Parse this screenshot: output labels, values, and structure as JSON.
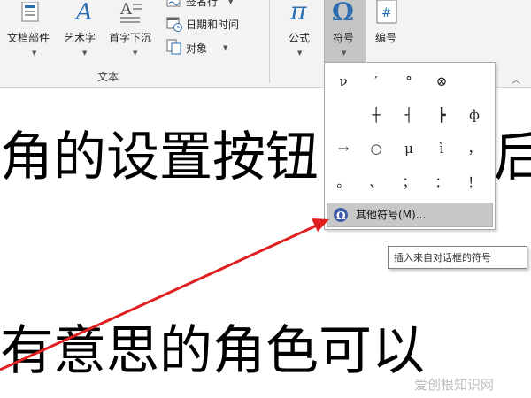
{
  "ribbon": {
    "doc_parts_label": "文档部件",
    "wordart_label": "艺术字",
    "dropcap_label": "首字下沉",
    "signature_label": "签名行",
    "datetime_label": "日期和时间",
    "object_label": "对象",
    "group_label": "文本",
    "equation_label": "公式",
    "symbol_label": "符号",
    "numbering_label": "编号"
  },
  "symbol_panel": {
    "symbols": [
      "ν",
      "′",
      "°",
      "⊗",
      "",
      "",
      "┼",
      "┤",
      "┣",
      "ф",
      "→",
      "○",
      "μ",
      "ì",
      "，",
      "。",
      "、",
      "；",
      "：",
      "！"
    ],
    "more_symbols_label": "其他符号(M)..."
  },
  "tooltip": {
    "text": "插入来自对话框的符号"
  },
  "document": {
    "line1": "角的设置按钮",
    "line1_tail": "后",
    "line2": "有意思的角色可以"
  },
  "watermark": "爱创根知识网",
  "colors": {
    "arrow": "#e02020",
    "ribbon_bg": "#f3f3f3",
    "pressed": "#c5c5c5"
  }
}
